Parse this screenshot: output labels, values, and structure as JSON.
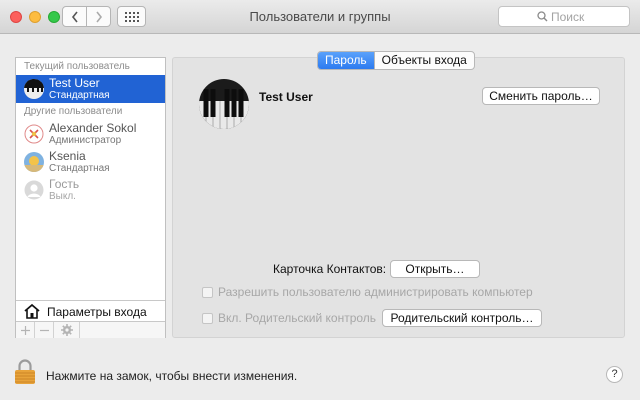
{
  "window": {
    "title": "Пользователи и группы"
  },
  "search": {
    "placeholder": "Поиск"
  },
  "sidebar": {
    "current_header": "Текущий пользователь",
    "others_header": "Другие пользователи",
    "current_user": {
      "name": "Test User",
      "role": "Стандартная"
    },
    "other_users": [
      {
        "name": "Alexander Sokol",
        "role": "Администратор"
      },
      {
        "name": "Ksenia",
        "role": "Стандартная"
      },
      {
        "name": "Гость",
        "role": "Выкл."
      }
    ],
    "login_options": "Параметры входа"
  },
  "tabs": [
    {
      "label": "Пароль"
    },
    {
      "label": "Объекты входа"
    }
  ],
  "detail": {
    "user_name": "Test User",
    "change_password": "Сменить пароль…",
    "contacts_label": "Карточка Контактов:",
    "open_button": "Открыть…",
    "allow_admin": "Разрешить пользователю администрировать компьютер",
    "parental_toggle": "Вкл. Родительский контроль",
    "parental_button": "Родительский контроль…"
  },
  "footer": {
    "lock_text": "Нажмите на замок, чтобы внести изменения.",
    "help": "?"
  },
  "colors": {
    "selection": "#2163d4",
    "segment_active": "#2d7bf0"
  }
}
